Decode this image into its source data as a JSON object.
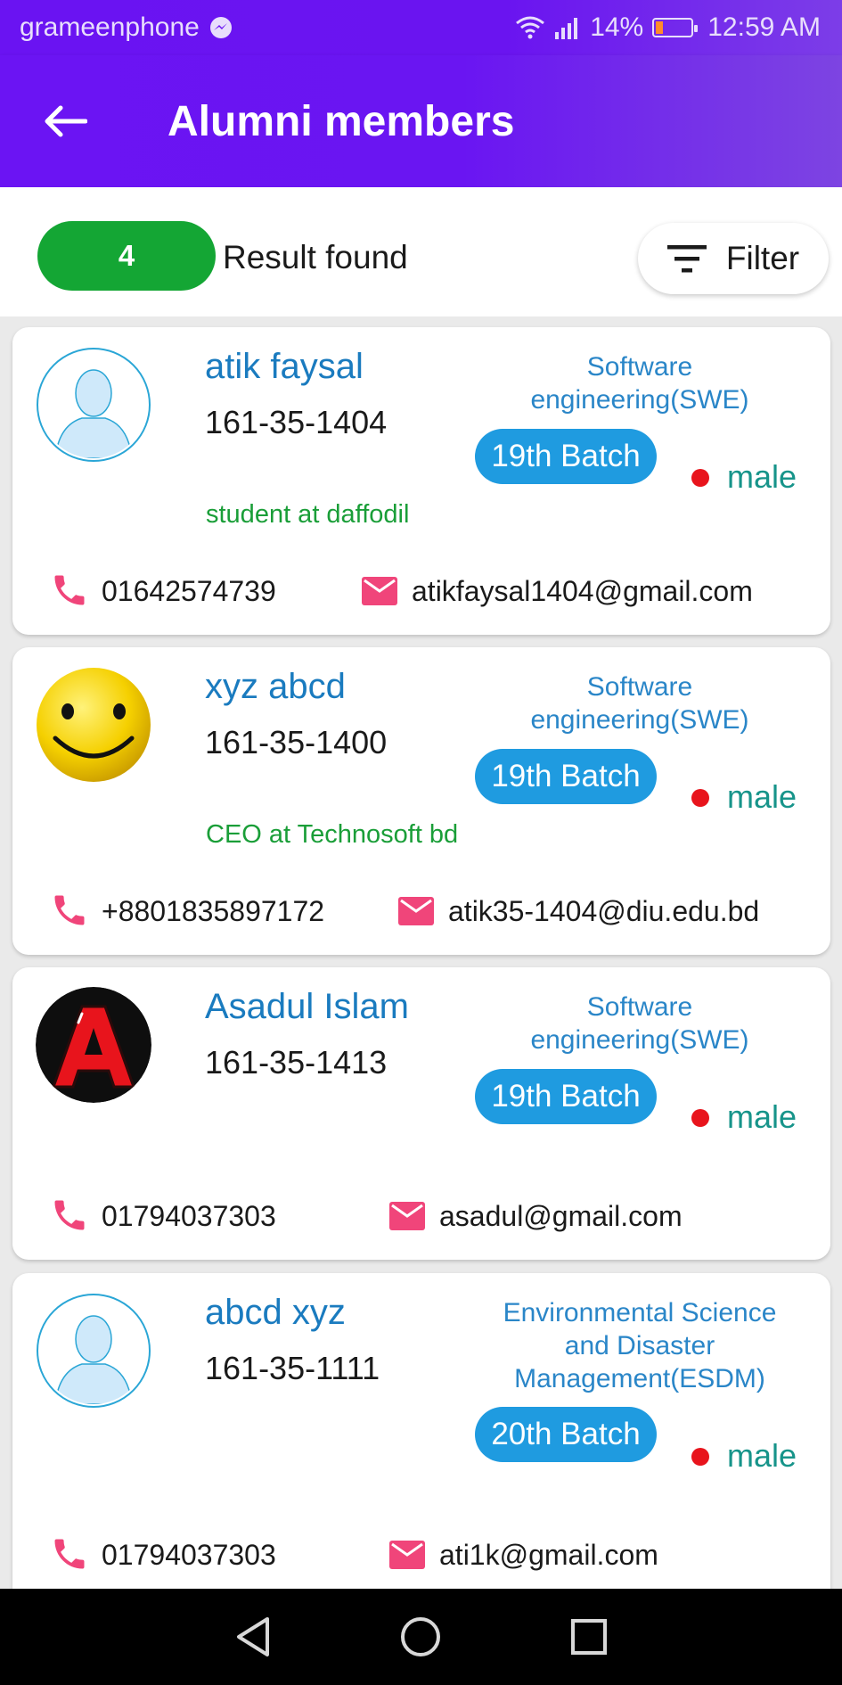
{
  "status_bar": {
    "carrier": "grameenphone",
    "battery": "14%",
    "time": "12:59 AM"
  },
  "header": {
    "title": "Alumni members"
  },
  "results": {
    "count": "4",
    "label": "Result found",
    "filter_label": "Filter"
  },
  "members": [
    {
      "name": "atik faysal",
      "student_id": "161-35-1404",
      "department": "Software engineering(SWE)",
      "batch": "19th Batch",
      "gender": "male",
      "occupation": "student at daffodil",
      "phone": "01642574739",
      "email": "atikfaysal1404@gmail.com",
      "avatar": "default-user-avatar"
    },
    {
      "name": "xyz abcd",
      "student_id": "161-35-1400",
      "department": "Software engineering(SWE)",
      "batch": "19th Batch",
      "gender": "male",
      "occupation": "CEO at Technosoft bd",
      "phone": "+8801835897172",
      "email": "atik35-1404@diu.edu.bd",
      "avatar": "smiley-face-avatar"
    },
    {
      "name": "Asadul Islam",
      "student_id": "161-35-1413",
      "department": "Software engineering(SWE)",
      "batch": "19th Batch",
      "gender": "male",
      "occupation": "",
      "phone": "01794037303",
      "email": "asadul@gmail.com",
      "avatar": "letter-a-avatar"
    },
    {
      "name": "abcd xyz",
      "student_id": "161-35-1111",
      "department": "Environmental Science and Disaster Management(ESDM)",
      "batch": "20th Batch",
      "gender": "male",
      "occupation": "",
      "phone": "01794037303",
      "email": "ati1k@gmail.com",
      "avatar": "default-user-avatar"
    }
  ],
  "colors": {
    "app_bar": "#6a14f2",
    "count_pill": "#14a634",
    "batch_pill": "#1f9be0",
    "name_text": "#1a7bbf",
    "department_text": "#2a86c8",
    "occupation_text": "#1a9e38",
    "gender_text": "#17948a",
    "gender_dot": "#e8141c",
    "contact_icons": "#f0457a"
  },
  "nav_bar": {
    "icons": [
      "back-triangle-icon",
      "home-circle-icon",
      "recents-square-icon"
    ]
  }
}
